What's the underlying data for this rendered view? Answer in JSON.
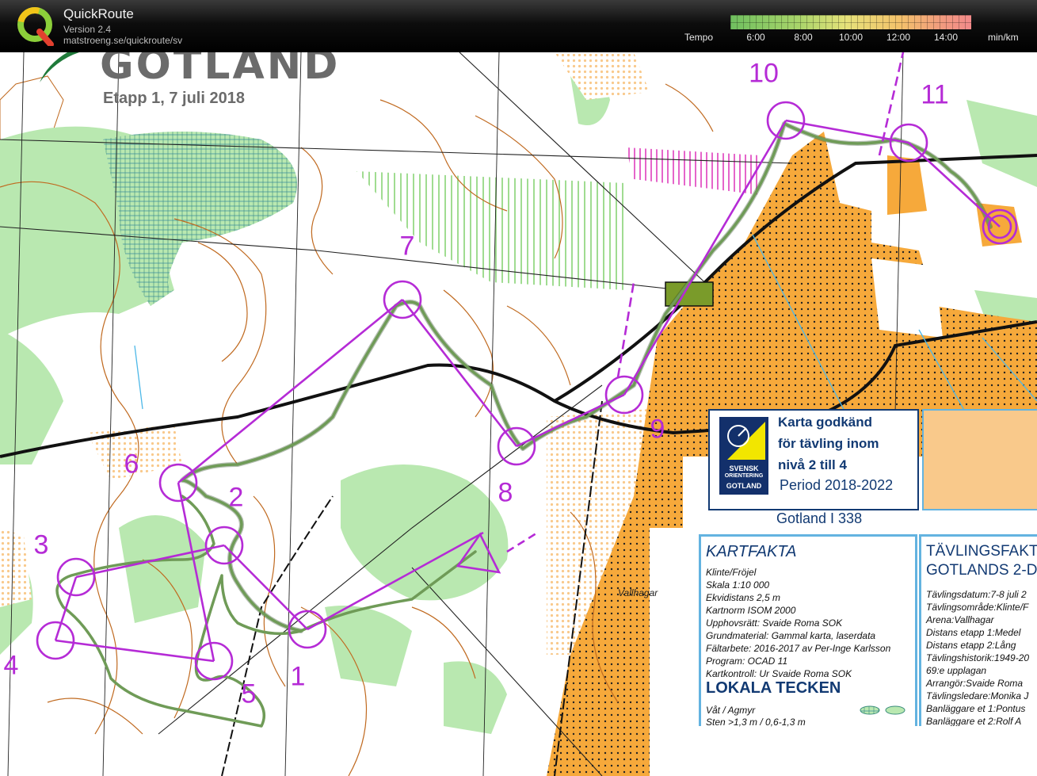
{
  "app": {
    "name": "QuickRoute",
    "version": "Version 2.4",
    "url": "matstroeng.se/quickroute/sv"
  },
  "tempo": {
    "label": "Tempo",
    "unit": "min/km",
    "ticks": [
      "6:00",
      "8:00",
      "10:00",
      "12:00",
      "14:00"
    ],
    "colors": [
      "#6fbf5f",
      "#e6e27a",
      "#f38a8a"
    ]
  },
  "map": {
    "title": "GOTLAND",
    "subtitle": "Etapp 1, 7 juli 2018",
    "place": "Vallhagar",
    "route_color": "#6f9b57",
    "course_color": "#b52bd6",
    "controls": [
      "1",
      "2",
      "3",
      "4",
      "5",
      "6",
      "7",
      "8",
      "9",
      "10",
      "11"
    ]
  },
  "approval": {
    "badge_lines": [
      "SVENSK",
      "ORIENTERING",
      "GOTLAND"
    ],
    "lines": [
      "Karta godkänd",
      "för tävling inom",
      "nivå 2 till 4"
    ],
    "period": "Period 2018-2022",
    "map_id": "Gotland I 338"
  },
  "kartfakta": {
    "title": "KARTFAKTA",
    "lines": [
      "Klinte/Fröjel",
      "Skala 1:10 000",
      "Ekvidistans 2,5 m",
      "Kartnorm ISOM 2000",
      "Upphovsrätt: Svaide Roma SOK",
      "Grundmaterial: Gammal karta, laserdata",
      "Fältarbete: 2016-2017 av Per-Inge Karlsson",
      "Program: OCAD 11",
      "Kartkontroll: Ur Svaide Roma SOK"
    ],
    "local_title": "LOKALA TECKEN",
    "local_lines": [
      "Våt / Agmyr",
      "Sten >1,3 m / 0,6-1,3 m"
    ]
  },
  "tavlingsfakta": {
    "title_lines": [
      "TÄVLINGSFAKT",
      "GOTLANDS 2-D"
    ],
    "lines": [
      "Tävlingsdatum:7-8 juli 2",
      "Tävlingsområde:Klinte/F",
      "Arena:Vallhagar",
      "Distans etapp 1:Medel",
      "Distans etapp 2:Lång",
      "Tävlingshistorik:1949-20",
      "69:e upplagan",
      "Arrangör:Svaide Roma",
      "Tävlingsledare:Monika J",
      "Banläggare et 1:Pontus",
      "Banläggare et 2:Rolf A"
    ]
  }
}
